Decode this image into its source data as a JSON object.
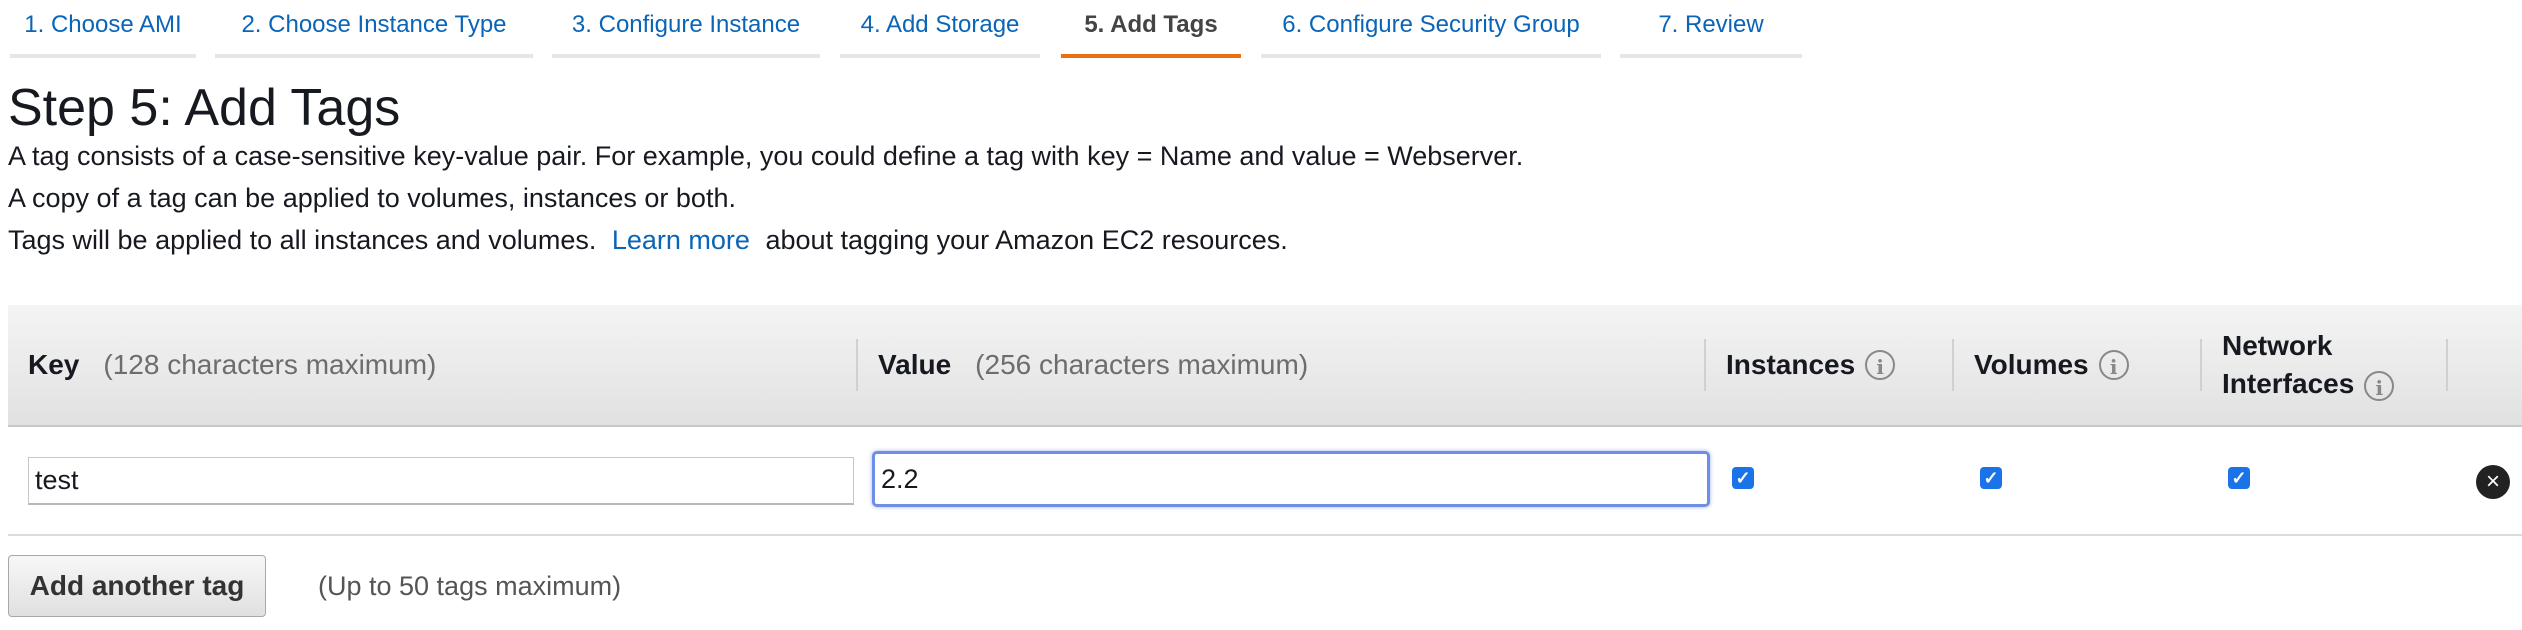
{
  "wizard": {
    "steps": [
      {
        "label": "1. Choose AMI"
      },
      {
        "label": "2. Choose Instance Type"
      },
      {
        "label": "3. Configure Instance"
      },
      {
        "label": "4. Add Storage"
      },
      {
        "label": "5. Add Tags",
        "active": true
      },
      {
        "label": "6. Configure Security Group"
      },
      {
        "label": "7. Review"
      }
    ]
  },
  "page": {
    "title": "Step 5: Add Tags",
    "line1": "A tag consists of a case-sensitive key-value pair. For example, you could define a tag with key = Name and value = Webserver.",
    "line2": "A copy of a tag can be applied to volumes, instances or both.",
    "line3_before": "Tags will be applied to all instances and volumes.",
    "line3_link": "Learn more",
    "line3_after": "about tagging your Amazon EC2 resources."
  },
  "table": {
    "headers": {
      "key": "Key",
      "key_hint": "(128 characters maximum)",
      "value": "Value",
      "value_hint": "(256 characters maximum)",
      "instances": "Instances",
      "volumes": "Volumes",
      "network_line1": "Network",
      "network_line2": "Interfaces"
    },
    "rows": [
      {
        "key": "test",
        "value": "2.2",
        "instances": true,
        "volumes": true,
        "network_interfaces": true
      }
    ]
  },
  "actions": {
    "add_tag_label": "Add another tag",
    "add_tag_note": "(Up to 50 tags maximum)"
  },
  "colors": {
    "link": "#0a65b8",
    "active_tab_underline": "#ec7211",
    "checkbox": "#1a73e8",
    "focus_border": "#6f8fe6"
  },
  "icons": {
    "info": "info-circle-icon",
    "check": "checkmark-icon",
    "remove": "close-circle-icon"
  }
}
